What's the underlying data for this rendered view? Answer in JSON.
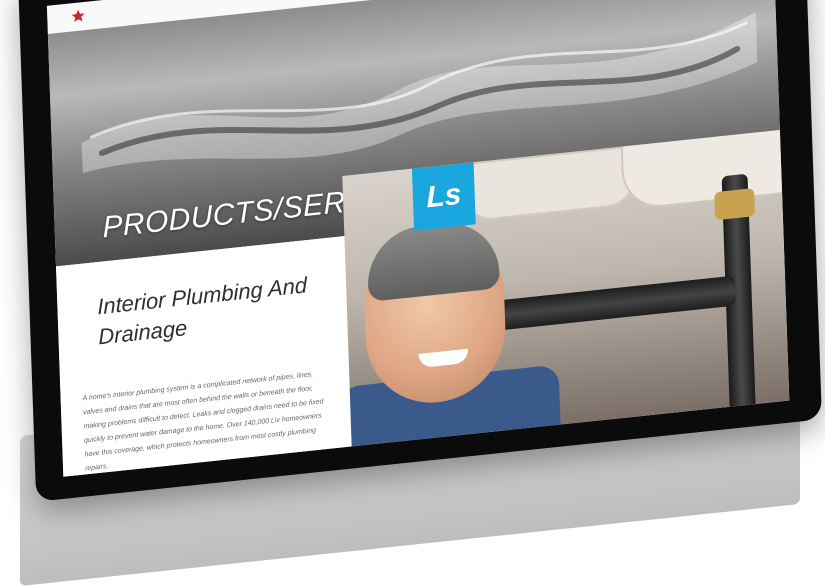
{
  "site": {
    "logo": {
      "title": "",
      "subtitle": ""
    }
  },
  "hero": {
    "title": "PRODUCTS/SERVICES"
  },
  "content": {
    "heading": "Interior Plumbing And Drainage",
    "body": "A home's interior plumbing system is a complicated network of pipes, lines, valves and drains that are most often behind the walls or beneath the floor, making problems difficult to detect. Leaks and clogged drains need to be fixed quickly to prevent water damage to the home. Over 140,000 Liv homeowners have this coverage, which protects homeowners from most costly plumbing repairs."
  },
  "photo": {
    "brand_mark": "Ls"
  },
  "colors": {
    "accent_blue": "#1aa6de",
    "logo_red": "#c62828"
  },
  "icons": [
    "star-icon"
  ]
}
